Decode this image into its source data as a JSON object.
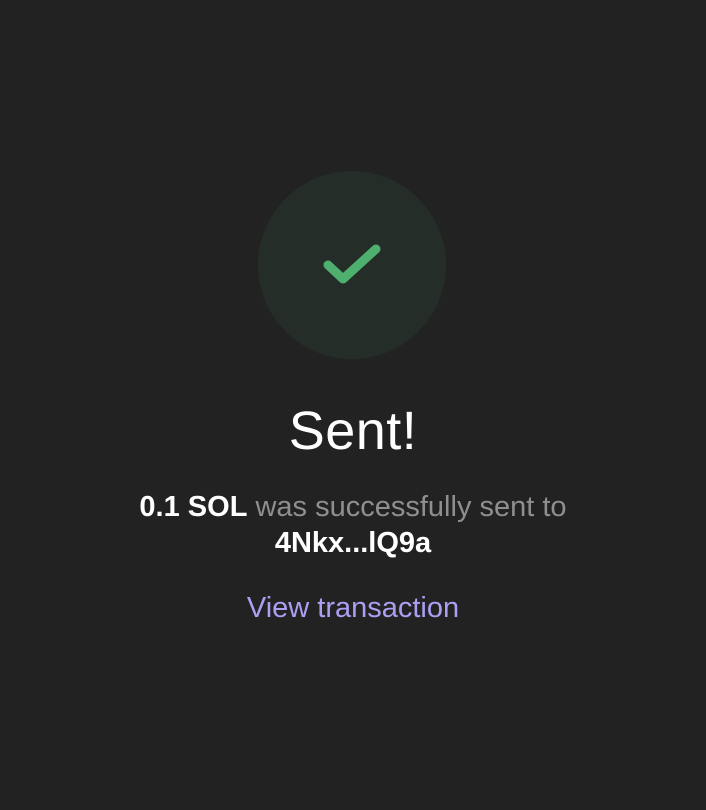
{
  "colors": {
    "background": "#222222",
    "success_circle": "#252d29",
    "checkmark": "#4faf6e",
    "title_text": "#ffffff",
    "muted_text": "#8f8f8f",
    "link": "#ab9ff2"
  },
  "icon": "checkmark-icon",
  "title": "Sent!",
  "message": {
    "amount": "0.1 SOL",
    "text": "was successfully sent to",
    "recipient": "4Nkx...lQ9a"
  },
  "link_label": "View transaction"
}
